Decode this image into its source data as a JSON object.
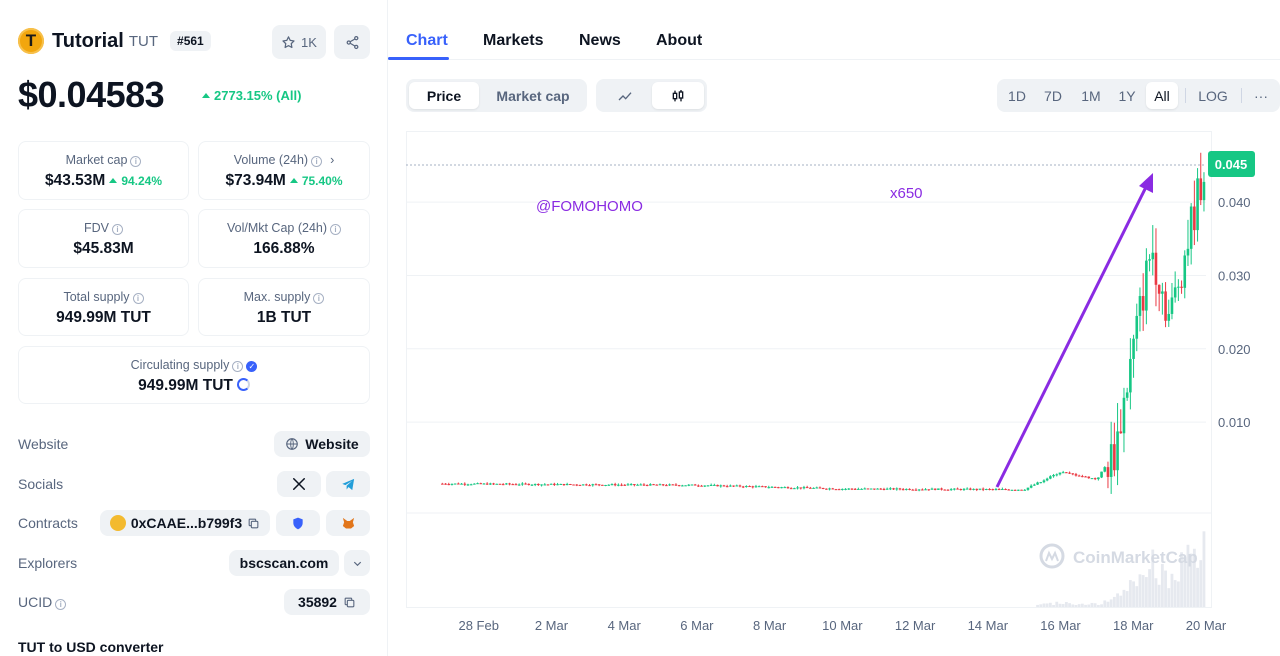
{
  "coin": {
    "logo_letter": "T",
    "name": "Tutorial",
    "symbol": "TUT",
    "rank": "#561",
    "watchlist_count": "1K",
    "price": "$0.04583",
    "price_change": "2773.15% (All)"
  },
  "stats": {
    "market_cap": {
      "label": "Market cap",
      "value": "$43.53M",
      "change": "94.24%"
    },
    "volume": {
      "label": "Volume (24h)",
      "value": "$73.94M",
      "change": "75.40%"
    },
    "fdv": {
      "label": "FDV",
      "value": "$45.83M"
    },
    "vol_mkt_cap": {
      "label": "Vol/Mkt Cap (24h)",
      "value": "166.88%"
    },
    "total_supply": {
      "label": "Total supply",
      "value": "949.99M TUT"
    },
    "max_supply": {
      "label": "Max. supply",
      "value": "1B TUT"
    },
    "circulating_supply": {
      "label": "Circulating supply",
      "value": "949.99M TUT"
    }
  },
  "links": {
    "website_label": "Website",
    "website_button": "Website",
    "socials_label": "Socials",
    "contracts_label": "Contracts",
    "contract_address": "0xCAAE...b799f3",
    "explorers_label": "Explorers",
    "explorer_value": "bscscan.com",
    "ucid_label": "UCID",
    "ucid_value": "35892",
    "converter_title": "TUT to USD converter"
  },
  "tabs": [
    "Chart",
    "Markets",
    "News",
    "About"
  ],
  "chart_controls": {
    "type_options": [
      "Price",
      "Market cap"
    ],
    "selected_type": "Price",
    "ranges": [
      "1D",
      "7D",
      "1M",
      "1Y",
      "All"
    ],
    "selected_range": "All",
    "log_label": "LOG",
    "more_label": "···"
  },
  "colors": {
    "accent": "#3861fb",
    "up": "#16c784",
    "down": "#ea3943",
    "annotation": "#8a2be2"
  },
  "chart_data": {
    "type": "candlestick",
    "watermark": "CoinMarketCap",
    "current_price_label": "0.045",
    "annotations": [
      "@FOMOHOMO",
      "x650"
    ],
    "y_ticks": [
      "0.040",
      "0.030",
      "0.020",
      "0.010"
    ],
    "x_ticks": [
      "28 Feb",
      "2 Mar",
      "4 Mar",
      "6 Mar",
      "8 Mar",
      "10 Mar",
      "12 Mar",
      "14 Mar",
      "16 Mar",
      "18 Mar",
      "20 Mar"
    ],
    "ylim": [
      -0.0024,
      0.0497
    ],
    "xlim": [
      "26 Feb",
      "20 Mar"
    ],
    "approx_price_path": [
      {
        "date": "27 Feb",
        "price": 0.0016
      },
      {
        "date": "2 Mar",
        "price": 0.0015
      },
      {
        "date": "6 Mar",
        "price": 0.0014
      },
      {
        "date": "10 Mar",
        "price": 0.0009
      },
      {
        "date": "15 Mar",
        "price": 0.0008
      },
      {
        "date": "16 Mar",
        "price": 0.0032
      },
      {
        "date": "17 Mar",
        "price": 0.0022
      },
      {
        "date": "17.5 Mar",
        "price": 0.006
      },
      {
        "date": "18 Mar",
        "price": 0.02
      },
      {
        "date": "18.5 Mar",
        "price": 0.034
      },
      {
        "date": "19 Mar",
        "price": 0.024
      },
      {
        "date": "20 Mar",
        "price": 0.0458
      }
    ]
  }
}
